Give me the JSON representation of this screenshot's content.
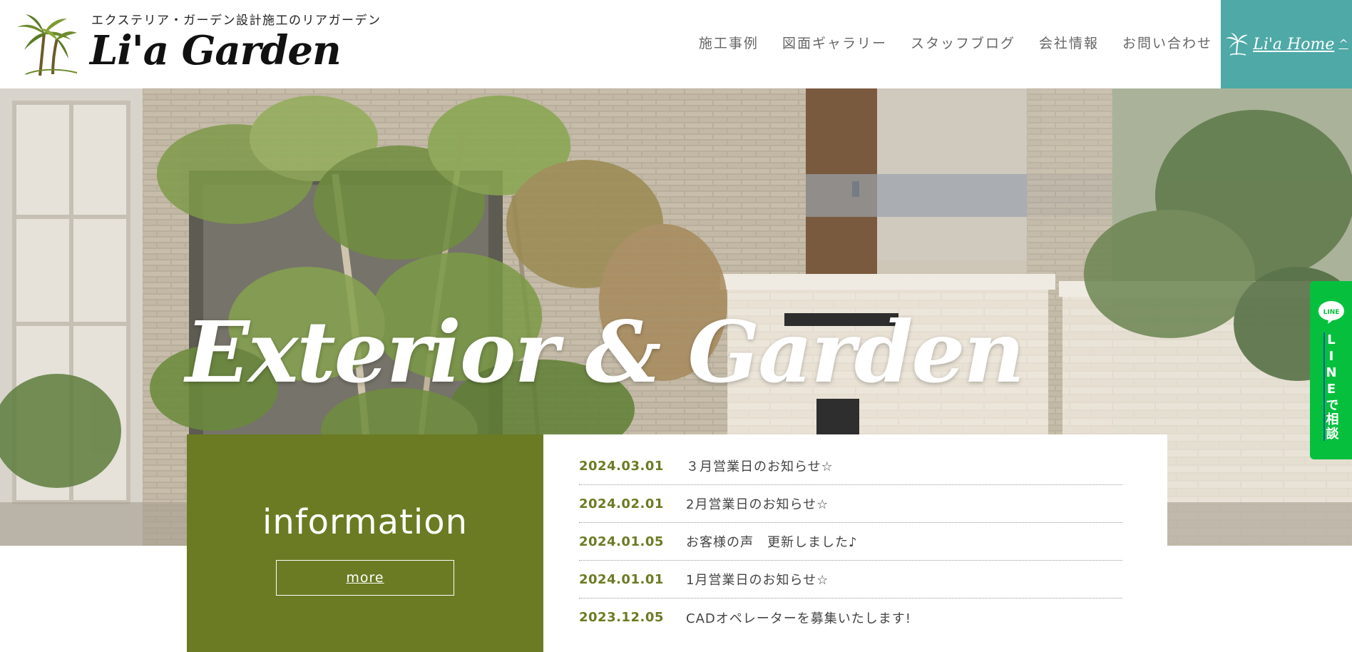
{
  "header": {
    "tagline": "エクステリア・ガーデン設計施工のリアガーデン",
    "logo_text": "Li'a Garden",
    "nav": [
      {
        "label": "施工事例"
      },
      {
        "label": "図面ギャラリー"
      },
      {
        "label": "スタッフブログ"
      },
      {
        "label": "会社情報"
      },
      {
        "label": "お問い合わせ"
      }
    ],
    "home_button": {
      "label": "Li'a Home",
      "chevron": "^"
    }
  },
  "hero": {
    "title": "Exterior & Garden"
  },
  "information": {
    "heading": "information",
    "more_label": "more",
    "news": [
      {
        "date": "2024.03.01",
        "title": "３月営業日のお知らせ☆"
      },
      {
        "date": "2024.02.01",
        "title": "2月営業日のお知らせ☆"
      },
      {
        "date": "2024.01.05",
        "title": "お客様の声　更新しました♪"
      },
      {
        "date": "2024.01.01",
        "title": "1月営業日のお知らせ☆"
      },
      {
        "date": "2023.12.05",
        "title": "CADオペレーターを募集いたします!"
      }
    ]
  },
  "line_tab": {
    "icon_label": "LINE",
    "text": "LINEで相談"
  },
  "colors": {
    "accent_teal": "#4ea9a7",
    "info_olive": "#6b7b23",
    "line_green": "#06c03d"
  },
  "icons": {
    "logo": "palm-trees-icon",
    "home": "palm-tree-icon",
    "line": "line-chat-bubble-icon"
  }
}
